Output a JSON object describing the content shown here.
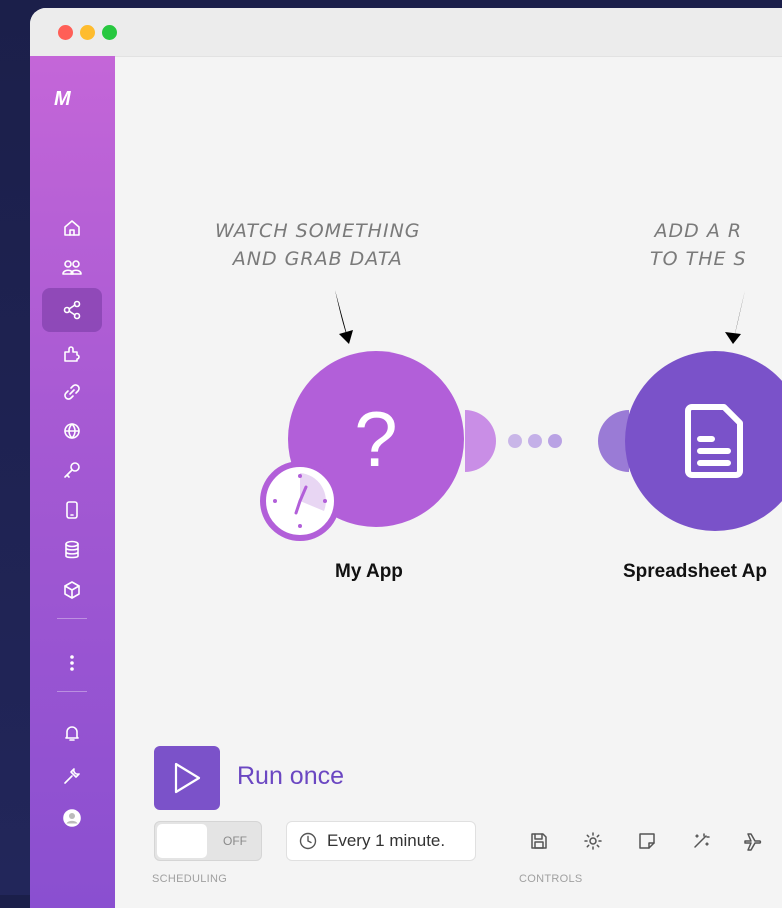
{
  "app": {
    "logo_text": "M"
  },
  "sidebar": {
    "items": [
      {
        "name": "home-icon"
      },
      {
        "name": "team-icon"
      },
      {
        "name": "scenarios-icon",
        "active": true
      },
      {
        "name": "templates-icon"
      },
      {
        "name": "connections-icon"
      },
      {
        "name": "webhooks-icon"
      },
      {
        "name": "keys-icon"
      },
      {
        "name": "devices-icon"
      },
      {
        "name": "datastores-icon"
      },
      {
        "name": "datastructures-icon"
      },
      {
        "name": "more-icon"
      },
      {
        "name": "notifications-icon"
      },
      {
        "name": "settings-icon"
      },
      {
        "name": "profile-icon"
      }
    ]
  },
  "canvas": {
    "note1": "WATCH SOMETHING\nAND GRAB DATA",
    "note2": "ADD A R\nTO THE S",
    "module1": {
      "label": "My App",
      "icon": "question-icon"
    },
    "module2": {
      "label": "Spreadsheet Ap",
      "icon": "document-icon"
    }
  },
  "bottom": {
    "run_label": "Run once",
    "toggle_text": "OFF",
    "schedule_text": "Every 1 minute.",
    "scheduling_label": "SCHEDULING",
    "controls_label": "CONTROLS"
  },
  "colors": {
    "accent": "#7b52c9",
    "module1": "#b25fd9",
    "module2": "#7a52c9"
  }
}
